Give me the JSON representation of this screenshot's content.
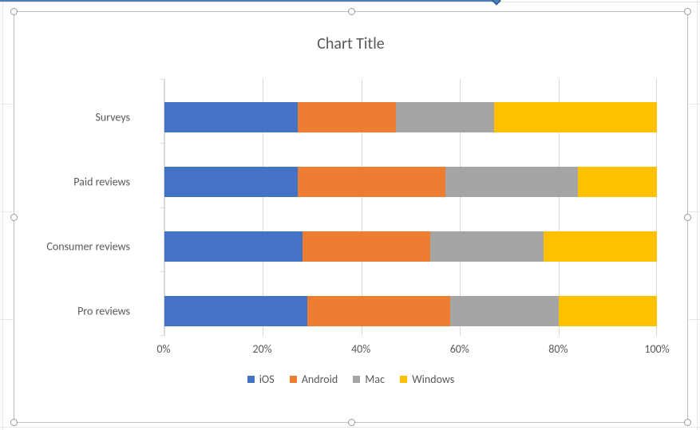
{
  "chart_data": {
    "type": "bar",
    "stacked": "100%",
    "orientation": "horizontal",
    "title": "Chart Title",
    "categories": [
      "Pro reviews",
      "Consumer reviews",
      "Paid reviews",
      "Surveys"
    ],
    "series": [
      {
        "name": "iOS",
        "color": "#4472C4",
        "values": [
          29,
          28,
          27,
          27
        ]
      },
      {
        "name": "Android",
        "color": "#ED7D31",
        "values": [
          29,
          26,
          30,
          20
        ]
      },
      {
        "name": "Mac",
        "color": "#A5A5A5",
        "values": [
          22,
          23,
          27,
          20
        ]
      },
      {
        "name": "Windows",
        "color": "#FFC000",
        "values": [
          20,
          23,
          16,
          33
        ]
      }
    ],
    "x_ticks": [
      0,
      20,
      40,
      60,
      80,
      100
    ],
    "x_tick_labels": [
      "0%",
      "20%",
      "40%",
      "60%",
      "80%",
      "100%"
    ],
    "xlim": [
      0,
      100
    ]
  },
  "ui": {
    "selected": true
  }
}
